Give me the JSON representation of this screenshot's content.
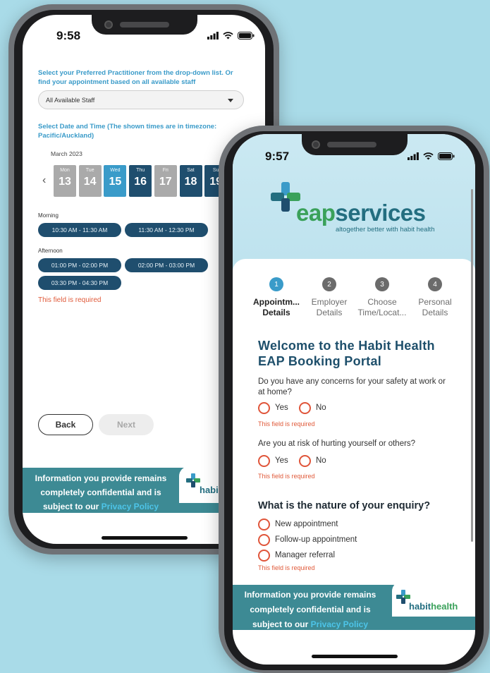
{
  "left_phone": {
    "status_time": "9:58",
    "practitioner_instruction": "Select your Preferred Practitioner from the drop-down list. Or find your appointment based on all available staff",
    "practitioner_selected": "All Available Staff",
    "datetime_instruction": "Select Date and Time (The shown times are in timezone: Pacific/Auckland)",
    "month_label": "March 2023",
    "prev_arrow": "‹",
    "days": [
      {
        "name": "Mon",
        "num": "13",
        "state": "unavailable"
      },
      {
        "name": "Tue",
        "num": "14",
        "state": "unavailable"
      },
      {
        "name": "Wed",
        "num": "15",
        "state": "selected"
      },
      {
        "name": "Thu",
        "num": "16",
        "state": "available"
      },
      {
        "name": "Fri",
        "num": "17",
        "state": "unavailable"
      },
      {
        "name": "Sat",
        "num": "18",
        "state": "available"
      },
      {
        "name": "Su",
        "num": "19",
        "state": "available"
      }
    ],
    "morning_label": "Morning",
    "morning_slots": [
      "10:30 AM - 11:30 AM",
      "11:30 AM - 12:30 PM"
    ],
    "afternoon_label": "Afternoon",
    "afternoon_slots": [
      "01:00 PM - 02:00 PM",
      "02:00 PM - 03:00 PM",
      "03:30 PM - 04:30 PM"
    ],
    "error": "This field is required",
    "back_label": "Back",
    "next_label": "Next",
    "footer_line1": "Information you provide remains",
    "footer_line2": "completely confidential and is",
    "footer_line3_pre": "subject to our ",
    "footer_link": "Privacy Policy",
    "footer_logo_text": "habi"
  },
  "right_phone": {
    "status_time": "9:57",
    "brand_name_1": "eap",
    "brand_name_2": "services",
    "brand_tagline": "altogether better with habit health",
    "steps": [
      {
        "num": "1",
        "line1": "Appointm...",
        "line2": "Details",
        "active": true
      },
      {
        "num": "2",
        "line1": "Employer",
        "line2": "Details",
        "active": false
      },
      {
        "num": "3",
        "line1": "Choose",
        "line2": "Time/Locat...",
        "active": false
      },
      {
        "num": "4",
        "line1": "Personal",
        "line2": "Details",
        "active": false
      }
    ],
    "welcome_line1": "Welcome to the Habit Health",
    "welcome_line2": "EAP Booking Portal",
    "q1": "Do you have any concerns for your safety at work or at home?",
    "q2": "Are you at risk of hurting yourself or others?",
    "yes_label": "Yes",
    "no_label": "No",
    "error": "This field is required",
    "enquiry_title": "What is the nature of your enquiry?",
    "enquiry_options": [
      "New appointment",
      "Follow-up appointment",
      "Manager referral"
    ],
    "footer_line1": "Information you provide remains",
    "footer_line2": "completely confidential and is",
    "footer_line3_pre": "subject to our ",
    "footer_link": "Privacy Policy",
    "footer_logo_1": "habit",
    "footer_logo_2": "health"
  },
  "colors": {
    "background": "#a9dbe8",
    "accent_blue": "#3a9bc9",
    "navy": "#1f4e6e",
    "teal_footer": "#3d8a94",
    "error_red": "#e05a3a",
    "radio_ring": "#e0553a",
    "logo_green": "#3aa15a",
    "logo_blue": "#236e80"
  }
}
